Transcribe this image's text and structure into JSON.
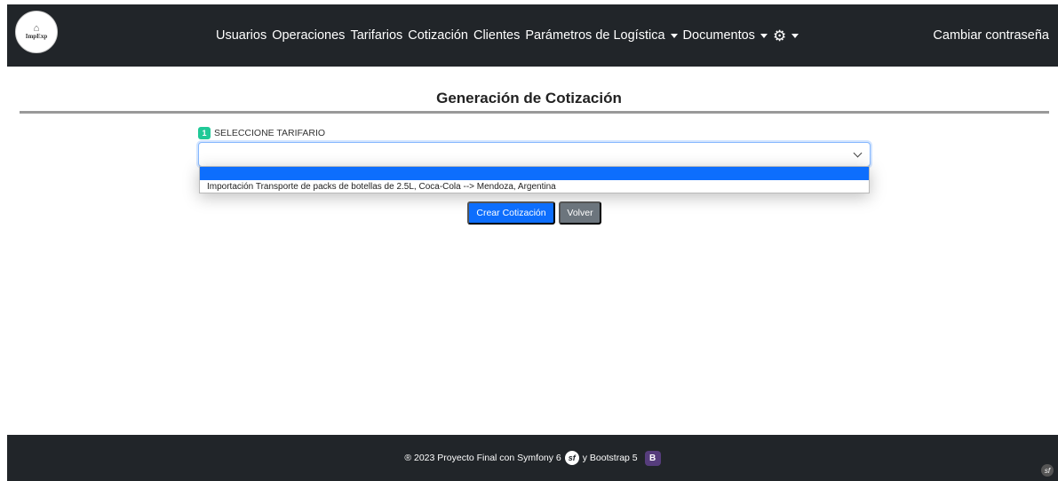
{
  "brand": {
    "logo_text": "ImpExp"
  },
  "nav": {
    "items": [
      {
        "label": "Usuarios",
        "dropdown": false
      },
      {
        "label": "Operaciones",
        "dropdown": false
      },
      {
        "label": "Tarifarios",
        "dropdown": false
      },
      {
        "label": "Cotización",
        "dropdown": false
      },
      {
        "label": "Clientes",
        "dropdown": false
      },
      {
        "label": "Parámetros de Logística",
        "dropdown": true
      },
      {
        "label": "Documentos",
        "dropdown": true
      }
    ],
    "settings_icon": "gear-icon",
    "right_link": "Cambiar contraseña"
  },
  "page": {
    "title": "Generación de Cotización",
    "step_number": "1",
    "step_label": "SELECCIONE TARIFARIO"
  },
  "select": {
    "value": "",
    "options": [
      "",
      "Importación Transporte de packs de botellas de 2.5L, Coca-Cola --> Mendoza, Argentina"
    ]
  },
  "buttons": {
    "create": "Crear Cotización",
    "back": "Volver"
  },
  "footer": {
    "text_before": "® 2023 Proyecto Final con Symfony 6",
    "text_mid": "y Bootstrap 5",
    "bootstrap_logo": "B"
  },
  "colors": {
    "navbar": "#212529",
    "primary": "#0d6efd",
    "secondary": "#6c757d",
    "badge": "#20c997",
    "bootstrap": "#563d7c"
  }
}
